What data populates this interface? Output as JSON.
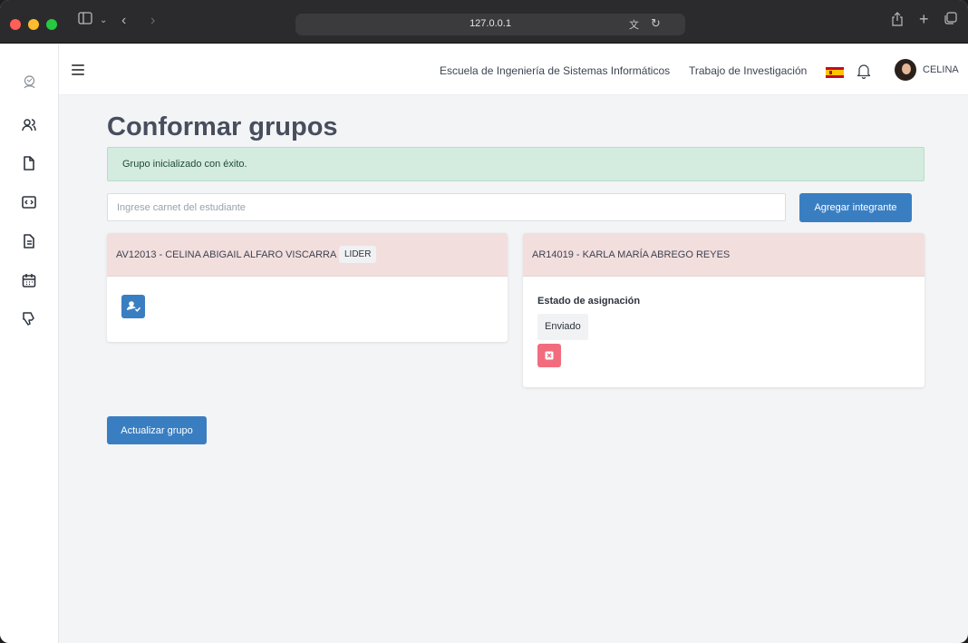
{
  "browser": {
    "url": "127.0.0.1"
  },
  "header": {
    "school_link": "Escuela de Ingeniería de Sistemas Informáticos",
    "research_link": "Trabajo de Investigación",
    "user_name": "CELINA"
  },
  "page": {
    "title": "Conformar grupos",
    "alert": "Grupo inicializado con éxito.",
    "search_placeholder": "Ingrese carnet del estudiante",
    "add_button": "Agregar integrante",
    "update_button": "Actualizar grupo"
  },
  "members": [
    {
      "label": "AV12013 - CELINA ABIGAIL ALFARO VISCARRA",
      "badge": "LIDER"
    },
    {
      "label": "AR14019 - KARLA MARÍA ABREGO REYES",
      "status_label": "Estado de asignación",
      "status_value": "Enviado"
    }
  ],
  "colors": {
    "primary": "#3a7ec2",
    "danger": "#f16d7d",
    "success_bg": "#d4ebe0",
    "card_header_bg": "#f3dede"
  },
  "icons": {
    "sidebar": [
      "users-icon",
      "file-icon",
      "code-window-icon",
      "document-icon",
      "calendar-icon",
      "thumbs-down-icon"
    ],
    "confirm_member": "user-check-icon",
    "remove_member": "close-square-icon"
  }
}
